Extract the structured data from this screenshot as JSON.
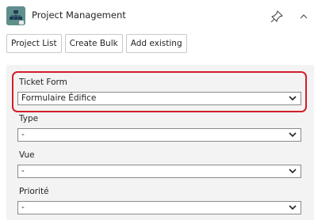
{
  "header": {
    "title": "Project Management",
    "app_icon": "org-chart-icon",
    "pin_icon": "pin-icon",
    "collapse_icon": "chevron-up-icon"
  },
  "toolbar": {
    "buttons": [
      {
        "label": "Project List"
      },
      {
        "label": "Create Bulk"
      },
      {
        "label": "Add existing"
      }
    ]
  },
  "form": {
    "fields": [
      {
        "label": "Ticket Form",
        "value": "Formulaire Édifice",
        "highlighted": true
      },
      {
        "label": "Type",
        "value": "-"
      },
      {
        "label": "Vue",
        "value": "-"
      },
      {
        "label": "Priorité",
        "value": "-"
      }
    ]
  },
  "colors": {
    "highlight_border": "#d11f26",
    "app_icon_bg": "#5e8f8b",
    "panel_bg": "#f3f3f3"
  }
}
